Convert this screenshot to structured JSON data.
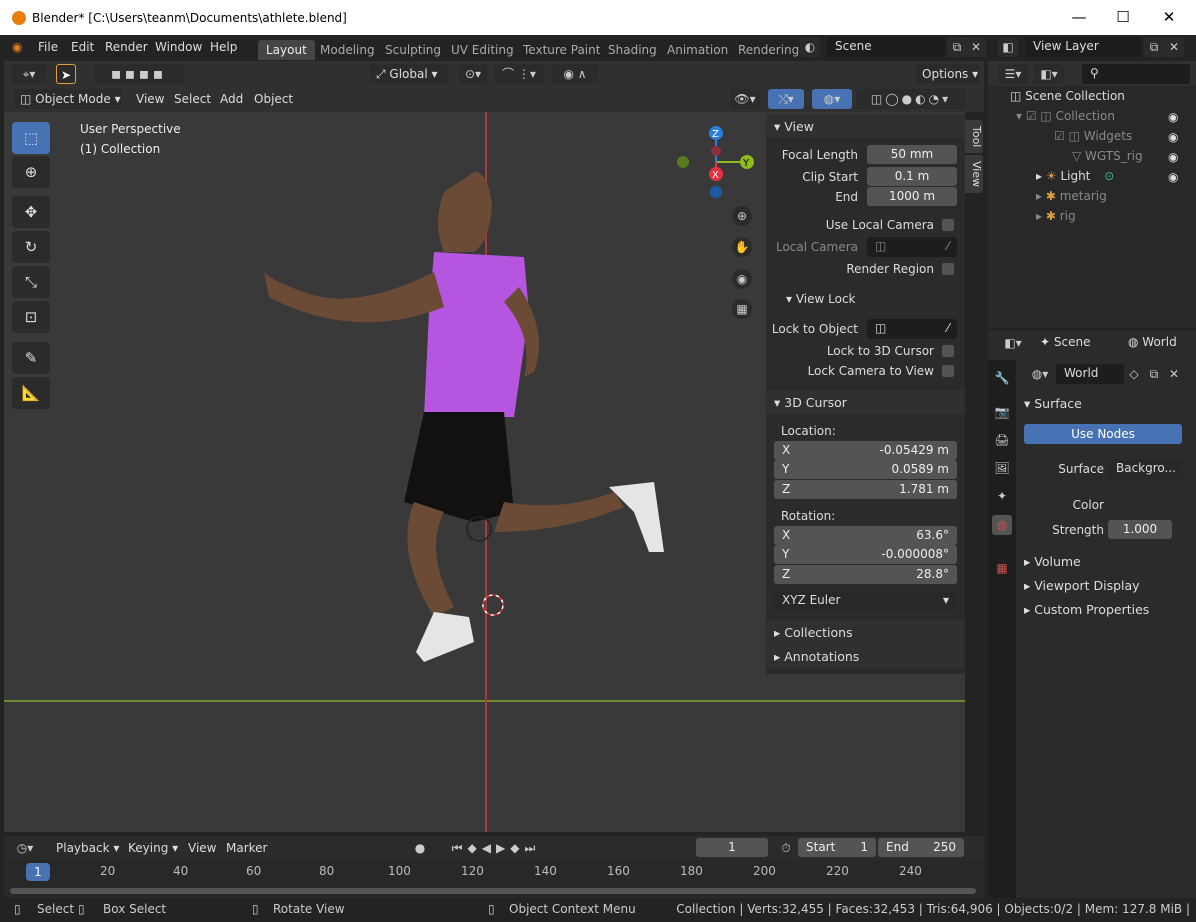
{
  "window": {
    "title": "Blender* [C:\\Users\\teanm\\Documents\\athlete.blend]",
    "minimize": "—",
    "maximize": "☐",
    "close": "✕"
  },
  "menu": {
    "items": [
      "File",
      "Edit",
      "Render",
      "Window",
      "Help"
    ]
  },
  "workspaces": [
    "Layout",
    "Modeling",
    "Sculpting",
    "UV Editing",
    "Texture Paint",
    "Shading",
    "Animation",
    "Rendering"
  ],
  "scene_field": "Scene",
  "view_layer_field": "View Layer",
  "toolbar": {
    "orientation": "Global",
    "options": "Options"
  },
  "header": {
    "mode": "Object Mode",
    "menus": [
      "View",
      "Select",
      "Add",
      "Object"
    ]
  },
  "viewport": {
    "perspective": "User Perspective",
    "collection": "(1) Collection",
    "gizmo": {
      "x": "X",
      "y": "Y",
      "z": "Z"
    }
  },
  "npanel": {
    "tabs": [
      "Tool",
      "View"
    ],
    "view": {
      "title": "View",
      "focal_label": "Focal Length",
      "focal": "50 mm",
      "clip_start_label": "Clip Start",
      "clip_start": "0.1 m",
      "end_label": "End",
      "end": "1000 m",
      "use_local_camera": "Use Local Camera",
      "local_camera": "Local Camera",
      "render_region": "Render Region"
    },
    "view_lock": {
      "title": "View Lock",
      "lock_obj": "Lock to Object",
      "lock_cursor": "Lock to 3D Cursor",
      "lock_cam": "Lock Camera to View"
    },
    "cursor": {
      "title": "3D Cursor",
      "location": "Location:",
      "lx": "X",
      "lxv": "-0.05429 m",
      "ly": "Y",
      "lyv": "0.0589 m",
      "lz": "Z",
      "lzv": "1.781 m",
      "rotation": "Rotation:",
      "rx": "X",
      "rxv": "63.6°",
      "ry": "Y",
      "ryv": "-0.000008°",
      "rz": "Z",
      "rzv": "28.8°",
      "mode": "XYZ Euler"
    },
    "collections": "Collections",
    "annotations": "Annotations"
  },
  "outliner": {
    "root": "Scene Collection",
    "rows": [
      "Collection",
      "Widgets",
      "WGTS_rig",
      "Light",
      "metarig",
      "rig"
    ]
  },
  "props": {
    "scene": "Scene",
    "world_tab": "World",
    "world_name": "World",
    "surface": "Surface",
    "use_nodes": "Use Nodes",
    "surface_label": "Surface",
    "surface_val": "Backgro...",
    "color_label": "Color",
    "strength_label": "Strength",
    "strength": "1.000",
    "volume": "Volume",
    "viewport_display": "Viewport Display",
    "custom_props": "Custom Properties"
  },
  "timeline": {
    "menus": [
      "Playback",
      "Keying",
      "View",
      "Marker"
    ],
    "frame": "1",
    "start_label": "Start",
    "start": "1",
    "end_label": "End",
    "end": "250",
    "current": "1",
    "ticks": [
      "20",
      "40",
      "60",
      "80",
      "100",
      "120",
      "140",
      "160",
      "180",
      "200",
      "220",
      "240"
    ]
  },
  "status": {
    "select": "Select",
    "box": "Box Select",
    "rotate": "Rotate View",
    "ctx": "Object Context Menu",
    "stats": "Collection | Verts:32,455 | Faces:32,453 | Tris:64,906 | Objects:0/2 | Mem: 127.8 MiB |"
  }
}
